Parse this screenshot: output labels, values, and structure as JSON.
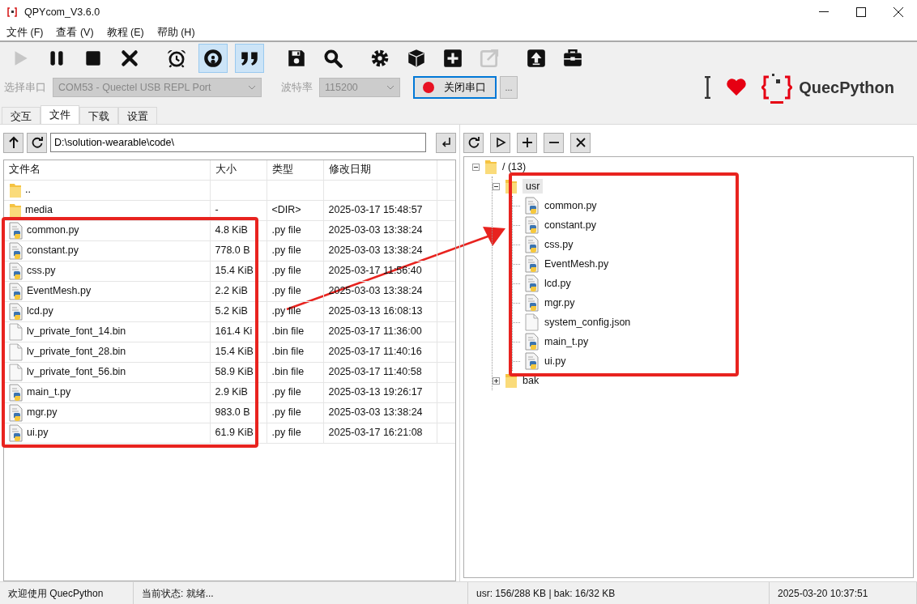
{
  "window": {
    "title": "QPYcom_V3.6.0"
  },
  "menu": [
    "文件 (F)",
    "查看 (V)",
    "教程 (E)",
    "帮助 (H)"
  ],
  "toolbar_groups": [
    [
      {
        "kind": "play",
        "disabled": true,
        "on": false
      },
      {
        "kind": "pause",
        "disabled": false,
        "on": false
      },
      {
        "kind": "stop",
        "disabled": false,
        "on": false
      },
      {
        "kind": "cross",
        "disabled": false,
        "on": false
      }
    ],
    [
      {
        "kind": "alarm",
        "disabled": false,
        "on": false
      },
      {
        "kind": "ring",
        "disabled": false,
        "on": true
      },
      {
        "kind": "quote",
        "disabled": false,
        "on": true
      }
    ],
    [
      {
        "kind": "save",
        "disabled": false,
        "on": false
      },
      {
        "kind": "search",
        "disabled": false,
        "on": false
      }
    ],
    [
      {
        "kind": "gear",
        "disabled": false,
        "on": false
      },
      {
        "kind": "cube",
        "disabled": false,
        "on": false
      },
      {
        "kind": "plus",
        "disabled": false,
        "on": false
      },
      {
        "kind": "export",
        "disabled": true,
        "on": false
      }
    ],
    [
      {
        "kind": "upload",
        "disabled": false,
        "on": false
      },
      {
        "kind": "toolbox",
        "disabled": false,
        "on": false
      }
    ]
  ],
  "serial": {
    "port_label": "选择串口",
    "port": "COM53 - Quectel USB REPL Port",
    "baud_label": "波特率",
    "baud": "115200",
    "disabled": true,
    "toggle_button": "关闭串口",
    "connected": true,
    "more_button": "..."
  },
  "brand": {
    "name": "QuecPython"
  },
  "tabs": [
    {
      "label": "交互",
      "selected": false
    },
    {
      "label": "文件",
      "selected": true
    },
    {
      "label": "下载",
      "selected": false
    },
    {
      "label": "设置",
      "selected": false
    }
  ],
  "local": {
    "path": "D:\\solution-wearable\\code\\",
    "columns": [
      "文件名",
      "大小",
      "类型",
      "修改日期"
    ],
    "rows": [
      {
        "kind": "folder",
        "name": "..",
        "size": "",
        "type": "",
        "date": ""
      },
      {
        "kind": "folder",
        "name": "media",
        "size": "-",
        "type": "<DIR>",
        "date": "2025-03-17 15:48:57"
      },
      {
        "kind": "py",
        "name": "common.py",
        "size": "4.8 KiB",
        "type": ".py file",
        "date": "2025-03-03 13:38:24"
      },
      {
        "kind": "py",
        "name": "constant.py",
        "size": "778.0 B",
        "type": ".py file",
        "date": "2025-03-03 13:38:24"
      },
      {
        "kind": "py",
        "name": "css.py",
        "size": "15.4 KiB",
        "type": ".py file",
        "date": "2025-03-17 11:56:40"
      },
      {
        "kind": "py",
        "name": "EventMesh.py",
        "size": "2.2 KiB",
        "type": ".py file",
        "date": "2025-03-03 13:38:24"
      },
      {
        "kind": "py",
        "name": "lcd.py",
        "size": "5.2 KiB",
        "type": ".py file",
        "date": "2025-03-13 16:08:13"
      },
      {
        "kind": "bin",
        "name": "lv_private_font_14.bin",
        "size": "161.4 Ki",
        "type": ".bin file",
        "date": "2025-03-17 11:36:00"
      },
      {
        "kind": "bin",
        "name": "lv_private_font_28.bin",
        "size": "15.4 KiB",
        "type": ".bin file",
        "date": "2025-03-17 11:40:16"
      },
      {
        "kind": "bin",
        "name": "lv_private_font_56.bin",
        "size": "58.9 KiB",
        "type": ".bin file",
        "date": "2025-03-17 11:40:58"
      },
      {
        "kind": "py",
        "name": "main_t.py",
        "size": "2.9 KiB",
        "type": ".py file",
        "date": "2025-03-13 19:26:17"
      },
      {
        "kind": "py",
        "name": "mgr.py",
        "size": "983.0 B",
        "type": ".py file",
        "date": "2025-03-03 13:38:24"
      },
      {
        "kind": "py",
        "name": "ui.py",
        "size": "61.9 KiB",
        "type": ".py file",
        "date": "2025-03-17 16:21:08"
      }
    ]
  },
  "device": {
    "tree": [
      {
        "kind": "folder",
        "label": "/ (13)",
        "expanded": true,
        "selected": false,
        "children": [
          {
            "kind": "folder",
            "label": "usr",
            "expanded": true,
            "selected": true,
            "children": [
              {
                "kind": "py",
                "label": "common.py"
              },
              {
                "kind": "py",
                "label": "constant.py"
              },
              {
                "kind": "py",
                "label": "css.py"
              },
              {
                "kind": "py",
                "label": "EventMesh.py"
              },
              {
                "kind": "py",
                "label": "lcd.py"
              },
              {
                "kind": "py",
                "label": "mgr.py"
              },
              {
                "kind": "file",
                "label": "system_config.json"
              },
              {
                "kind": "py",
                "label": "main_t.py"
              },
              {
                "kind": "py",
                "label": "ui.py"
              }
            ]
          },
          {
            "kind": "folder",
            "label": "bak",
            "expanded": false,
            "selected": false
          }
        ]
      }
    ]
  },
  "status_bar": [
    "欢迎使用 QuecPython",
    "当前状态: 就绪...",
    "usr: 156/288 KB | bak: 16/32 KB",
    "2025-03-20 10:37:51"
  ]
}
